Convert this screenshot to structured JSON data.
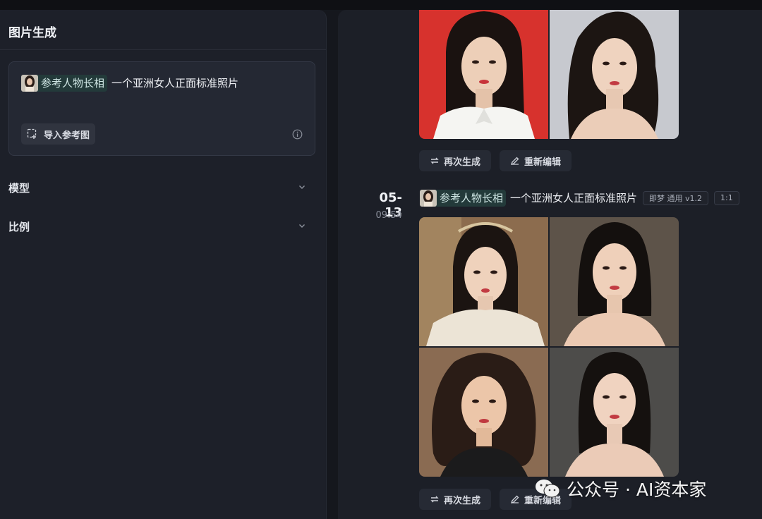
{
  "panel": {
    "title": "图片生成",
    "prompt": {
      "ref_label": "参考人物长相",
      "text": "一个亚洲女人正面标准照片"
    },
    "import_button": "导入参考图",
    "model_label": "模型",
    "ratio_label": "比例"
  },
  "history": [
    {
      "actions": {
        "regenerate": "再次生成",
        "reedit": "重新编辑"
      }
    },
    {
      "date": "05-13",
      "time": "09:54",
      "ref_label": "参考人物长相",
      "prompt": "一个亚洲女人正面标准照片",
      "model_tag": "即梦 通用 v1.2",
      "ratio_tag": "1:1",
      "actions": {
        "regenerate": "再次生成",
        "reedit": "重新编辑"
      }
    }
  ],
  "watermark": "公众号 · AI资本家",
  "icons": {
    "import": "image-import-icon",
    "info": "info-icon",
    "chevron": "chevron-down-icon",
    "regenerate": "refresh-icon",
    "edit": "pencil-icon",
    "wechat": "wechat-icon"
  },
  "colors": {
    "background": "#15171d",
    "panel": "#1d2029",
    "accent_chip": "#233a3a"
  }
}
